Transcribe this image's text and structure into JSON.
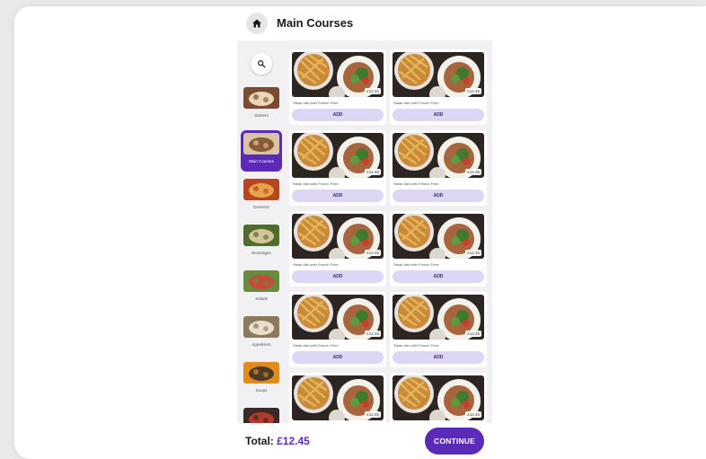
{
  "header": {
    "title": "Main Courses",
    "home_icon": "home-icon"
  },
  "sidebar": {
    "search_icon": "search-icon",
    "categories": [
      {
        "label": "Starters",
        "active": false
      },
      {
        "label": "Main Courses",
        "active": true
      },
      {
        "label": "Desserts",
        "active": false
      },
      {
        "label": "Beverages",
        "active": false
      },
      {
        "label": "Salads",
        "active": false
      },
      {
        "label": "Appetisers",
        "active": false
      },
      {
        "label": "Soups",
        "active": false
      },
      {
        "label": "",
        "active": false
      }
    ]
  },
  "items": [
    {
      "name": "Steak dish with French Fries",
      "price": "£12.45",
      "add_label": "ADD"
    },
    {
      "name": "Steak dish with French Fries",
      "price": "£12.45",
      "add_label": "ADD"
    },
    {
      "name": "Steak dish with French Fries",
      "price": "£12.45",
      "add_label": "ADD"
    },
    {
      "name": "Steak dish with French Fries",
      "price": "£12.45",
      "add_label": "ADD"
    },
    {
      "name": "Steak dish with French Fries",
      "price": "£12.45",
      "add_label": "ADD"
    },
    {
      "name": "Steak dish with French Fries",
      "price": "£12.45",
      "add_label": "ADD"
    },
    {
      "name": "Steak dish with French Fries",
      "price": "£12.45",
      "add_label": "ADD"
    },
    {
      "name": "Steak dish with French Fries",
      "price": "£12.45",
      "add_label": "ADD"
    },
    {
      "name": "",
      "price": "£12.45",
      "add_label": ""
    },
    {
      "name": "",
      "price": "£12.45",
      "add_label": ""
    }
  ],
  "footer": {
    "total_label": "Total:",
    "total_value": "£12.45",
    "continue_label": "CONTINUE"
  },
  "colors": {
    "accent": "#5b2ab8",
    "add_bg": "#ddd6f4"
  }
}
